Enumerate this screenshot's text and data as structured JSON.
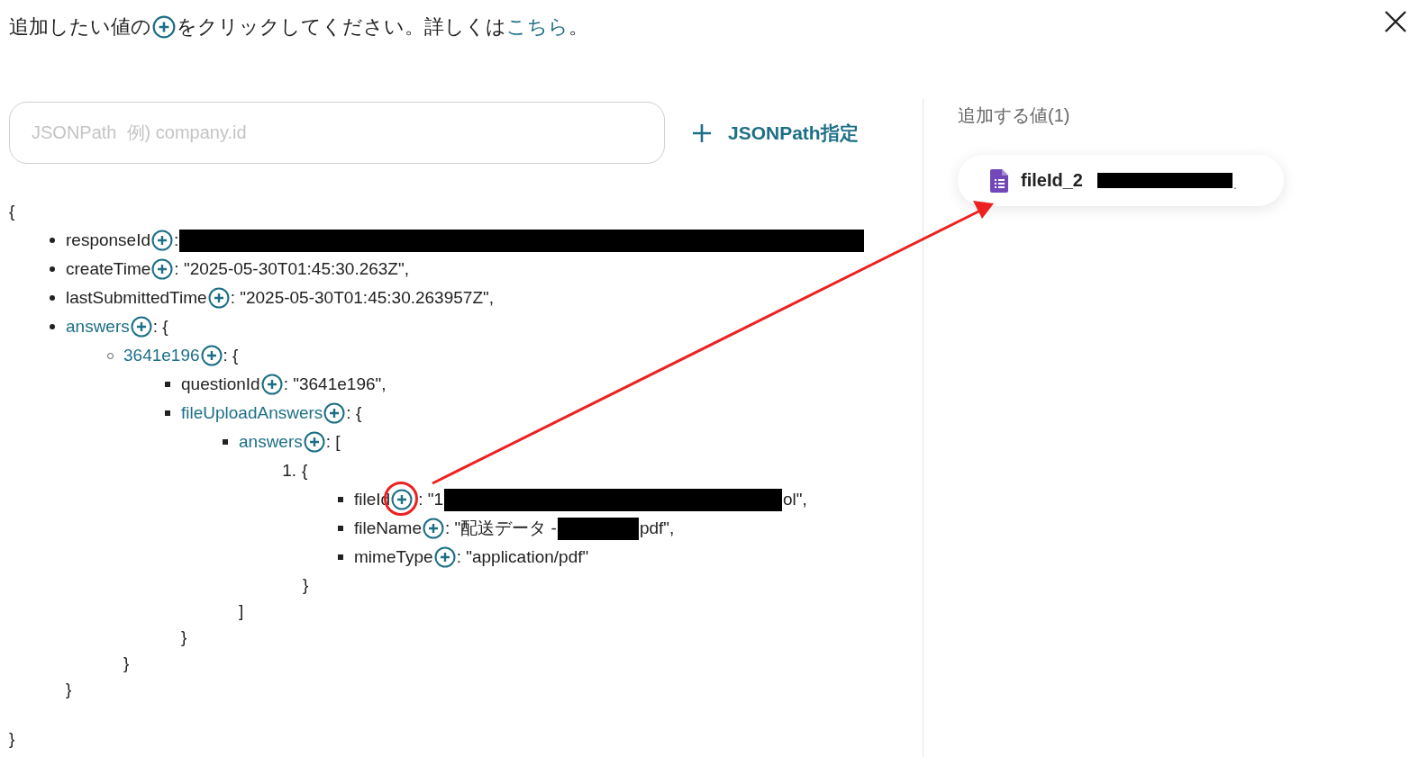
{
  "header": {
    "before": "追加したい値の",
    "after": "をクリックしてください。詳しくは",
    "link": "こちら",
    "end": "。"
  },
  "search": {
    "placeholder": "JSONPath  例) company.id"
  },
  "jsonpath_button": {
    "label": "JSONPath指定"
  },
  "tree": {
    "open": "{",
    "close": "}",
    "children": [
      {
        "kind": "disc",
        "key": "responseId",
        "link": false,
        "parts": [
          {
            "kind": "text",
            "text": ":"
          },
          {
            "kind": "redaction"
          }
        ]
      },
      {
        "kind": "disc",
        "key": "createTime",
        "link": false,
        "parts": [
          {
            "kind": "text",
            "text": ": \"2025-05-30T01:45:30.263Z\","
          }
        ]
      },
      {
        "kind": "disc",
        "key": "lastSubmittedTime",
        "link": false,
        "parts": [
          {
            "kind": "text",
            "text": ": \"2025-05-30T01:45:30.263957Z\","
          }
        ]
      },
      {
        "kind": "disc",
        "key": "answers",
        "link": true,
        "parts": [
          {
            "kind": "text",
            "text": ": {"
          }
        ],
        "close": "}",
        "children": [
          {
            "kind": "circle",
            "key": "3641e196",
            "link": true,
            "parts": [
              {
                "kind": "text",
                "text": ": {"
              }
            ],
            "close": "}",
            "children": [
              {
                "kind": "square",
                "key": "questionId",
                "link": false,
                "parts": [
                  {
                    "kind": "text",
                    "text": ": \"3641e196\","
                  }
                ]
              },
              {
                "kind": "square",
                "key": "fileUploadAnswers",
                "link": true,
                "parts": [
                  {
                    "kind": "text",
                    "text": ": {"
                  }
                ],
                "close": "}",
                "children": [
                  {
                    "kind": "square",
                    "key": "answers",
                    "link": true,
                    "parts": [
                      {
                        "kind": "text",
                        "text": ": ["
                      }
                    ],
                    "close": "]",
                    "children": [
                      {
                        "kind": "number",
                        "number": "1.",
                        "parts": [
                          {
                            "kind": "text",
                            "text": "{"
                          }
                        ],
                        "close": "}",
                        "children": [
                          {
                            "kind": "square",
                            "key": "fileId",
                            "link": false,
                            "highlighted": true,
                            "parts": [
                              {
                                "kind": "text",
                                "text": ": \"1"
                              },
                              {
                                "kind": "redaction"
                              },
                              {
                                "kind": "text",
                                "text": "ol\","
                              }
                            ]
                          },
                          {
                            "kind": "square",
                            "key": "fileName",
                            "link": false,
                            "parts": [
                              {
                                "kind": "text",
                                "text": ": \"配送データ -"
                              },
                              {
                                "kind": "redaction"
                              },
                              {
                                "kind": "text",
                                "text": "pdf\","
                              }
                            ]
                          },
                          {
                            "kind": "square",
                            "key": "mimeType",
                            "link": false,
                            "parts": [
                              {
                                "kind": "text",
                                "text": ": \"application/pdf\""
                              }
                            ]
                          }
                        ]
                      }
                    ]
                  }
                ]
              }
            ]
          }
        ]
      }
    ]
  },
  "panel": {
    "title": "追加する値(1)",
    "chips": [
      {
        "label": "fileId_2",
        "redacted": true,
        "trail": "."
      }
    ]
  }
}
